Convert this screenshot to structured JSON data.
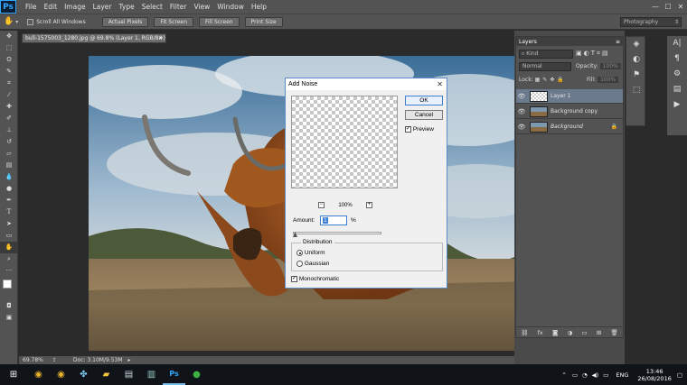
{
  "app": {
    "logo": "Ps",
    "menu": [
      "File",
      "Edit",
      "Image",
      "Layer",
      "Type",
      "Select",
      "Filter",
      "View",
      "Window",
      "Help"
    ],
    "window_controls": [
      "—",
      "☐",
      "✕"
    ]
  },
  "options_bar": {
    "scroll_all": "Scroll All Windows",
    "buttons": [
      "Actual Pixels",
      "Fit Screen",
      "Fill Screen",
      "Print Size"
    ],
    "workspace": "Photography"
  },
  "document": {
    "tab_label": "bull-1575003_1280.jpg @ 69.8% (Layer 1, RGB/8#) *",
    "zoom": "69.78%",
    "doc_info": "Doc: 3.10M/9.53M"
  },
  "layers_panel": {
    "tab": "Layers",
    "filter_kind": "Kind",
    "blend_mode": "Normal",
    "opacity_label": "Opacity:",
    "opacity_value": "100%",
    "lock_label": "Lock:",
    "fill_label": "Fill:",
    "fill_value": "100%",
    "layers": [
      {
        "name": "Layer 1",
        "selected": true
      },
      {
        "name": "Background copy",
        "selected": false
      },
      {
        "name": "Background",
        "selected": false
      }
    ]
  },
  "dialog": {
    "title": "Add Noise",
    "close": "✕",
    "ok": "OK",
    "cancel": "Cancel",
    "preview_label": "Preview",
    "preview_zoom": "100%",
    "amount_label": "Amount:",
    "amount_value": "1",
    "amount_unit": "%",
    "distribution_label": "Distribution",
    "uniform_label": "Uniform",
    "gaussian_label": "Gaussian",
    "monochromatic_label": "Monochromatic",
    "preview_checked": true,
    "uniform_selected": true,
    "monochromatic_checked": true
  },
  "taskbar": {
    "language": "ENG",
    "time": "13:46",
    "date": "26/08/2016"
  },
  "colors": {
    "accent": "#31a8ff",
    "panel": "#535353",
    "dialog_border": "#5c8cc8"
  }
}
